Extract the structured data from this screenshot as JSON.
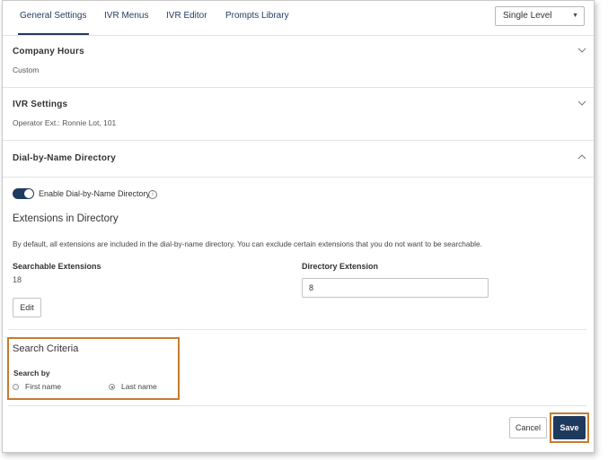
{
  "tabs": [
    {
      "label": "General Settings",
      "active": true
    },
    {
      "label": "IVR Menus",
      "active": false
    },
    {
      "label": "IVR Editor",
      "active": false
    },
    {
      "label": "Prompts Library",
      "active": false
    }
  ],
  "level_select": {
    "value": "Single Level"
  },
  "sections": {
    "company_hours": {
      "title": "Company Hours",
      "value": "Custom"
    },
    "ivr_settings": {
      "title": "IVR Settings",
      "value": "Operator Ext.: Ronnie Lot, 101"
    },
    "dial_by_name": {
      "title": "Dial-by-Name Directory"
    }
  },
  "directory": {
    "toggle_label": "Enable Dial-by-Name Directory",
    "toggle_on": true,
    "extensions_heading": "Extensions in Directory",
    "description": "By default, all extensions are included in the dial-by-name directory. You can exclude certain extensions that you do not want to be searchable.",
    "searchable_label": "Searchable Extensions",
    "searchable_count": "18",
    "edit_label": "Edit",
    "directory_ext_label": "Directory Extension",
    "directory_ext_value": "8"
  },
  "search_criteria": {
    "heading": "Search Criteria",
    "search_by_label": "Search by",
    "options": [
      {
        "label": "First name",
        "selected": false
      },
      {
        "label": "Last name",
        "selected": true
      }
    ]
  },
  "footer": {
    "cancel_label": "Cancel",
    "save_label": "Save"
  },
  "colors": {
    "accent": "#1f3a5f",
    "highlight": "#c97a2e"
  },
  "icons": {
    "chevron_down": "chevron-down-icon",
    "chevron_up": "chevron-up-icon",
    "info": "info-icon"
  }
}
